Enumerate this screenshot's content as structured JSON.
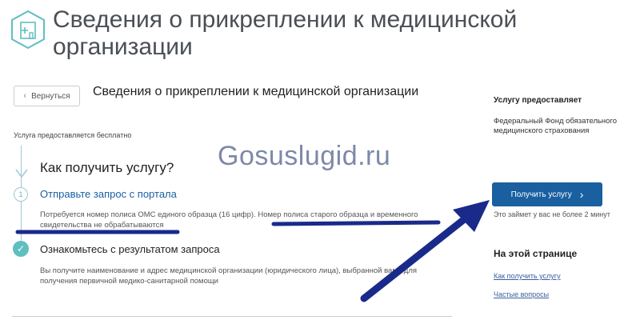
{
  "header": {
    "title": "Сведения о прикреплении к медицинской организации"
  },
  "nav": {
    "back_label": "Вернуться"
  },
  "page": {
    "title": "Сведения о прикреплении к медицинской организации",
    "free_note": "Услуга предоставляется бесплатно",
    "how_title": "Как получить услугу?"
  },
  "steps": [
    {
      "number": "1",
      "title": "Отправьте запрос с портала",
      "desc": "Потребуется номер полиса ОМС единого образца (16 цифр). Номер полиса старого образца и временного свидетельства не обрабатываются"
    },
    {
      "title": "Ознакомьтесь с результатом запроса",
      "desc": "Вы получите наименование и адрес медицинской организации (юридического лица), выбранной вами для получения первичной медико-санитарной помощи"
    }
  ],
  "sidebar": {
    "provider_label": "Услугу предоставляет",
    "provider_name": "Федеральный Фонд обязательного медицинского страхования",
    "button_label": "Получить услугу",
    "time_note": "Это займет у вас не более 2 минут",
    "onpage_title": "На этой странице",
    "links": [
      "Как получить услугу",
      "Частые вопросы"
    ]
  },
  "watermark": "Gosuslugid.ru",
  "colors": {
    "accent": "#1a5fa0",
    "annotation": "#1a2a8a",
    "check": "#5fbfc0"
  },
  "icons": [
    "hospital-icon",
    "chevron-left-icon",
    "chevron-right-icon",
    "check-icon",
    "arrow-down-icon"
  ]
}
